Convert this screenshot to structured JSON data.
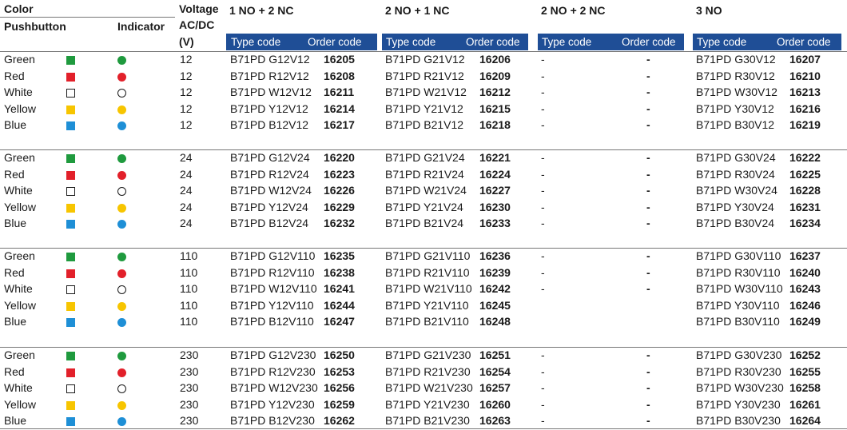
{
  "colors": {
    "header_blue": "#1f4e96",
    "green": "#1f9a3e",
    "red": "#e2202a",
    "white": "#ffffff",
    "yellow": "#f7c500",
    "blue": "#1e8fd6"
  },
  "headers": {
    "color": "Color",
    "pushbutton": "Pushbutton",
    "indicator": "Indicator",
    "voltage_line1": "Voltage",
    "voltage_line2": "AC/DC",
    "voltage_unit": "(V)",
    "groups": [
      "1 NO + 2 NC",
      "2 NO + 1 NC",
      "2 NO + 2 NC",
      "3 NO"
    ],
    "type_code": "Type code",
    "order_code": "Order code"
  },
  "blocks": [
    {
      "voltage": "12",
      "rows": [
        {
          "color_name": "Green",
          "color_key": "green",
          "cells": [
            [
              "B71PD G12V12",
              "16205"
            ],
            [
              "B71PD G21V12",
              "16206"
            ],
            [
              "-",
              "-"
            ],
            [
              "B71PD G30V12",
              "16207"
            ]
          ]
        },
        {
          "color_name": "Red",
          "color_key": "red",
          "cells": [
            [
              "B71PD R12V12",
              "16208"
            ],
            [
              "B71PD R21V12",
              "16209"
            ],
            [
              "-",
              "-"
            ],
            [
              "B71PD R30V12",
              "16210"
            ]
          ]
        },
        {
          "color_name": "White",
          "color_key": "white",
          "cells": [
            [
              "B71PD W12V12",
              "16211"
            ],
            [
              "B71PD W21V12",
              "16212"
            ],
            [
              "-",
              "-"
            ],
            [
              "B71PD W30V12",
              "16213"
            ]
          ]
        },
        {
          "color_name": "Yellow",
          "color_key": "yellow",
          "cells": [
            [
              "B71PD Y12V12",
              "16214"
            ],
            [
              "B71PD Y21V12",
              "16215"
            ],
            [
              "-",
              "-"
            ],
            [
              "B71PD Y30V12",
              "16216"
            ]
          ]
        },
        {
          "color_name": "Blue",
          "color_key": "blue",
          "cells": [
            [
              "B71PD B12V12",
              "16217"
            ],
            [
              "B71PD B21V12",
              "16218"
            ],
            [
              "-",
              "-"
            ],
            [
              "B71PD B30V12",
              "16219"
            ]
          ]
        }
      ]
    },
    {
      "voltage": "24",
      "rows": [
        {
          "color_name": "Green",
          "color_key": "green",
          "cells": [
            [
              "B71PD G12V24",
              "16220"
            ],
            [
              "B71PD G21V24",
              "16221"
            ],
            [
              "-",
              "-"
            ],
            [
              "B71PD G30V24",
              "16222"
            ]
          ]
        },
        {
          "color_name": "Red",
          "color_key": "red",
          "cells": [
            [
              "B71PD R12V24",
              "16223"
            ],
            [
              "B71PD R21V24",
              "16224"
            ],
            [
              "-",
              "-"
            ],
            [
              "B71PD R30V24",
              "16225"
            ]
          ]
        },
        {
          "color_name": "White",
          "color_key": "white",
          "cells": [
            [
              "B71PD W12V24",
              "16226"
            ],
            [
              "B71PD W21V24",
              "16227"
            ],
            [
              "-",
              "-"
            ],
            [
              "B71PD W30V24",
              "16228"
            ]
          ]
        },
        {
          "color_name": "Yellow",
          "color_key": "yellow",
          "cells": [
            [
              "B71PD Y12V24",
              "16229"
            ],
            [
              "B71PD Y21V24",
              "16230"
            ],
            [
              "-",
              "-"
            ],
            [
              "B71PD Y30V24",
              "16231"
            ]
          ]
        },
        {
          "color_name": "Blue",
          "color_key": "blue",
          "cells": [
            [
              "B71PD B12V24",
              "16232"
            ],
            [
              "B71PD B21V24",
              "16233"
            ],
            [
              "-",
              "-"
            ],
            [
              "B71PD B30V24",
              "16234"
            ]
          ]
        }
      ]
    },
    {
      "voltage": "110",
      "rows": [
        {
          "color_name": "Green",
          "color_key": "green",
          "cells": [
            [
              "B71PD G12V110",
              "16235"
            ],
            [
              "B71PD G21V110",
              "16236"
            ],
            [
              "-",
              "-"
            ],
            [
              "B71PD G30V110",
              "16237"
            ]
          ]
        },
        {
          "color_name": "Red",
          "color_key": "red",
          "cells": [
            [
              "B71PD R12V110",
              "16238"
            ],
            [
              "B71PD R21V110",
              "16239"
            ],
            [
              "-",
              "-"
            ],
            [
              "B71PD R30V110",
              "16240"
            ]
          ]
        },
        {
          "color_name": "White",
          "color_key": "white",
          "cells": [
            [
              "B71PD W12V110",
              "16241"
            ],
            [
              "B71PD W21V110",
              "16242"
            ],
            [
              "-",
              "-"
            ],
            [
              "B71PD W30V110",
              "16243"
            ]
          ]
        },
        {
          "color_name": "Yellow",
          "color_key": "yellow",
          "cells": [
            [
              "B71PD Y12V110",
              "16244"
            ],
            [
              "B71PD Y21V110",
              "16245"
            ],
            [
              "",
              ""
            ],
            [
              "B71PD Y30V110",
              "16246"
            ]
          ]
        },
        {
          "color_name": "Blue",
          "color_key": "blue",
          "cells": [
            [
              "B71PD B12V110",
              "16247"
            ],
            [
              "B71PD B21V110",
              "16248"
            ],
            [
              "",
              ""
            ],
            [
              "B71PD B30V110",
              "16249"
            ]
          ]
        }
      ]
    },
    {
      "voltage": "230",
      "rows": [
        {
          "color_name": "Green",
          "color_key": "green",
          "cells": [
            [
              "B71PD G12V230",
              "16250"
            ],
            [
              "B71PD G21V230",
              "16251"
            ],
            [
              "-",
              "-"
            ],
            [
              "B71PD G30V230",
              "16252"
            ]
          ]
        },
        {
          "color_name": "Red",
          "color_key": "red",
          "cells": [
            [
              "B71PD R12V230",
              "16253"
            ],
            [
              "B71PD R21V230",
              "16254"
            ],
            [
              "-",
              "-"
            ],
            [
              "B71PD R30V230",
              "16255"
            ]
          ]
        },
        {
          "color_name": "White",
          "color_key": "white",
          "cells": [
            [
              "B71PD W12V230",
              "16256"
            ],
            [
              "B71PD W21V230",
              "16257"
            ],
            [
              "-",
              "-"
            ],
            [
              "B71PD W30V230",
              "16258"
            ]
          ]
        },
        {
          "color_name": "Yellow",
          "color_key": "yellow",
          "cells": [
            [
              "B71PD Y12V230",
              "16259"
            ],
            [
              "B71PD Y21V230",
              "16260"
            ],
            [
              "-",
              "-"
            ],
            [
              "B71PD Y30V230",
              "16261"
            ]
          ]
        },
        {
          "color_name": "Blue",
          "color_key": "blue",
          "cells": [
            [
              "B71PD B12V230",
              "16262"
            ],
            [
              "B71PD B21V230",
              "16263"
            ],
            [
              "-",
              "-"
            ],
            [
              "B71PD B30V230",
              "16264"
            ]
          ]
        }
      ]
    }
  ]
}
